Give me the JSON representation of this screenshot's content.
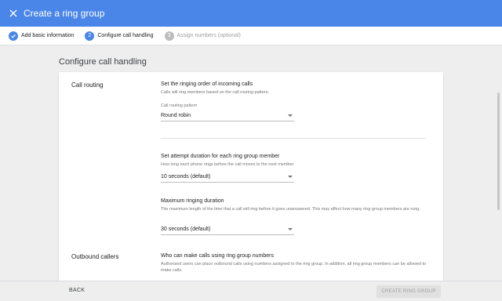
{
  "header": {
    "title": "Create a ring group",
    "close_icon": "close-icon"
  },
  "stepper": {
    "steps": [
      {
        "label": "Add basic information",
        "number": "1",
        "state": "done"
      },
      {
        "label": "Configure call handling",
        "number": "2",
        "state": "active"
      },
      {
        "label": "Assign numbers (optional)",
        "number": "3",
        "state": "pending"
      }
    ]
  },
  "main": {
    "section_title": "Configure call handling",
    "call_routing": {
      "label": "Call routing",
      "heading": "Set the ringing order of incoming calls",
      "description": "Calls will ring members based on the call routing pattern.",
      "pattern_field_label": "Call routing pattern",
      "pattern_value": "Round robin"
    },
    "attempt_duration": {
      "heading": "Set attempt duration for each ring group member",
      "description": "How long each phone rings before the call moves to the next member",
      "value": "10 seconds (default)"
    },
    "max_ringing": {
      "heading": "Maximum ringing duration",
      "description": "The maximum length of the time that a call will ring before it goes unanswered. This may affect how many ring group members are rung.",
      "value": "30 seconds (default)"
    },
    "outbound": {
      "label": "Outbound callers",
      "heading": "Who can make calls using ring group numbers",
      "description": "Authorized users can place outbound calls using numbers assigned to the ring group. In addition, all ring group members can be allowed to make calls."
    }
  },
  "footer": {
    "back_label": "BACK",
    "create_label": "CREATE RING GROUP"
  },
  "colors": {
    "accent": "#4a86e8",
    "disabled": "#9e9e9e"
  }
}
